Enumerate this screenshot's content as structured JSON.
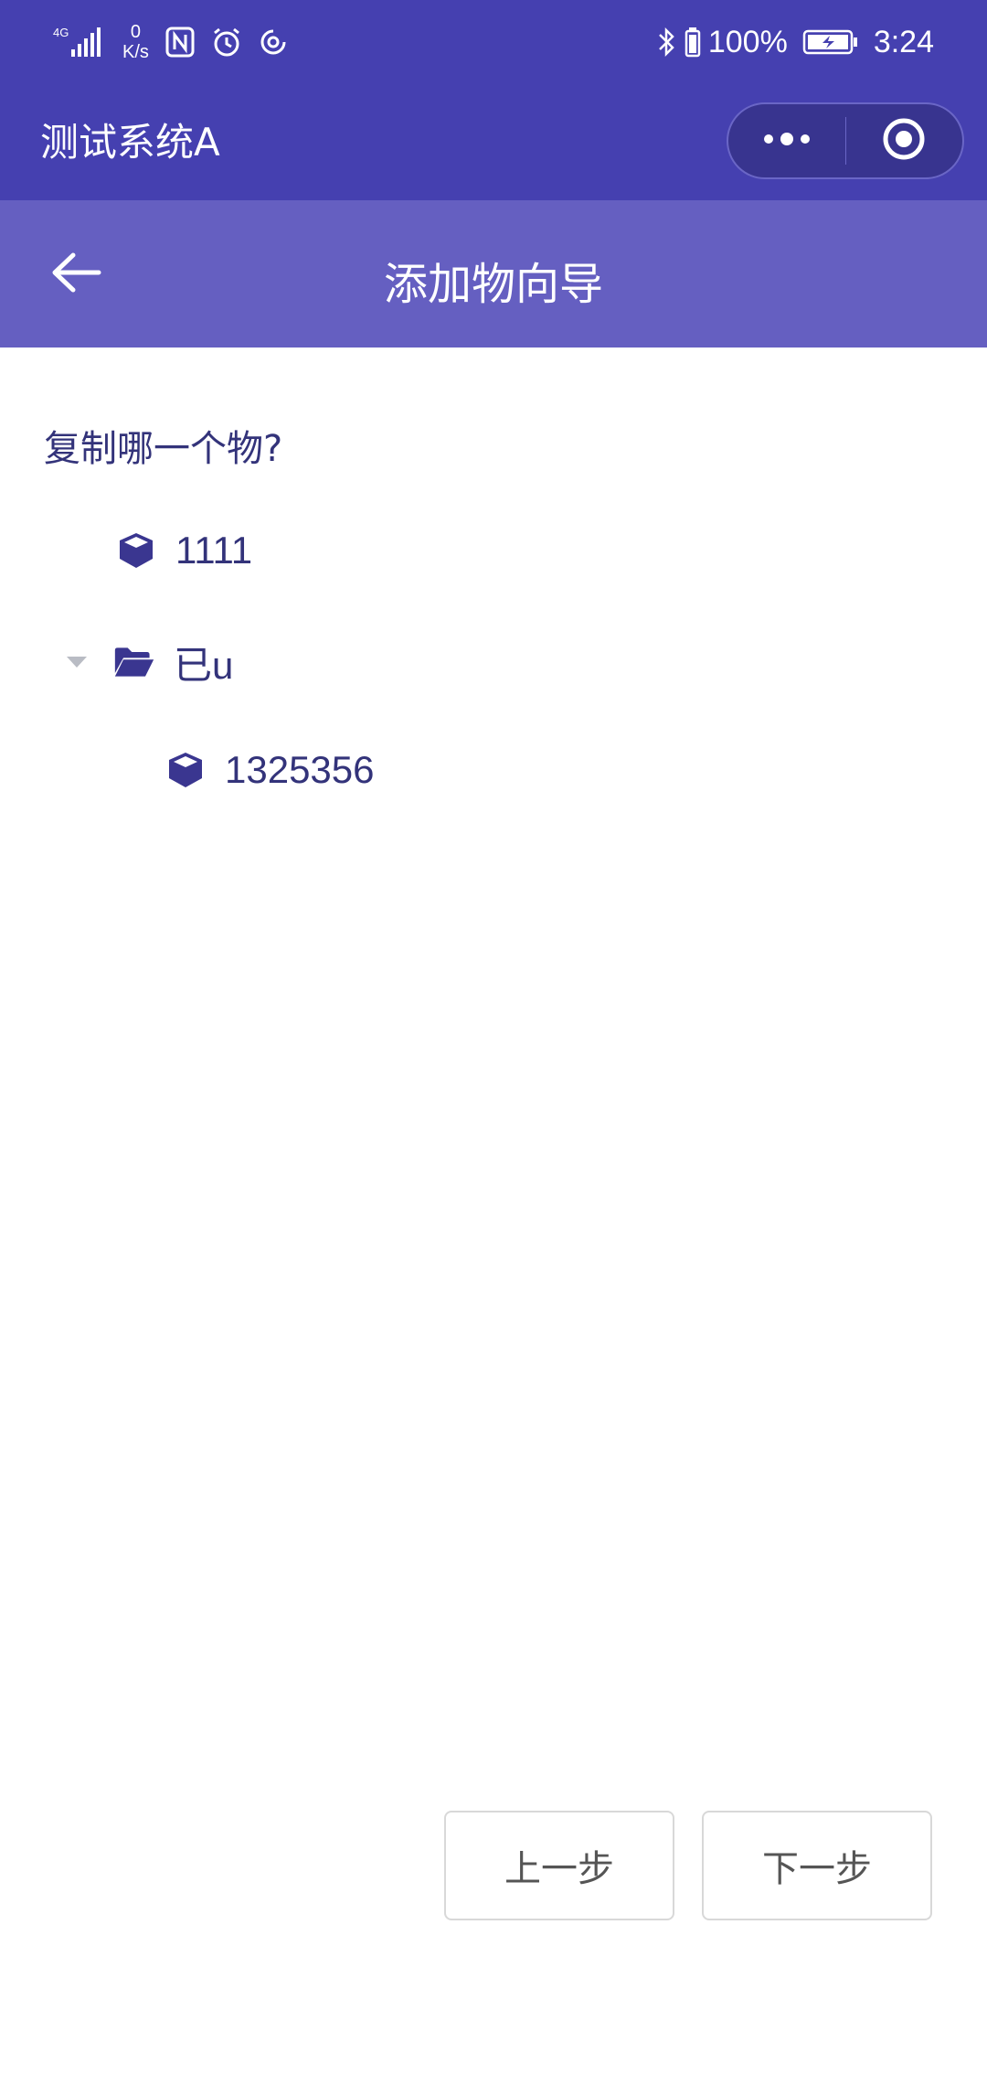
{
  "status_bar": {
    "network": "4G",
    "speed_value": "0",
    "speed_unit": "K/s",
    "battery": "100%",
    "time": "3:24",
    "icons_left": [
      "signal-icon",
      "nfc-icon",
      "alarm-icon",
      "sync-icon"
    ],
    "icons_right": [
      "bluetooth-icon",
      "battery-icon",
      "charging-battery-icon"
    ]
  },
  "title_bar": {
    "title": "测试系统A",
    "menu_icon": "more-dots-icon",
    "close_icon": "target-close-icon"
  },
  "nav": {
    "back_icon": "back-arrow-icon",
    "title": "添加物向导"
  },
  "content": {
    "question": "复制哪一个物?",
    "tree": [
      {
        "label": "1111",
        "icon": "cube-icon",
        "level": 1
      },
      {
        "label": "已u",
        "icon": "folder-open-icon",
        "expanded": true,
        "level": 1
      },
      {
        "label": "1325356",
        "icon": "cube-icon",
        "level": 2
      }
    ]
  },
  "buttons": {
    "prev": "上一步",
    "next": "下一步"
  },
  "colors": {
    "header": "#4540b0",
    "nav": "#655fc1",
    "text": "#33337a"
  }
}
